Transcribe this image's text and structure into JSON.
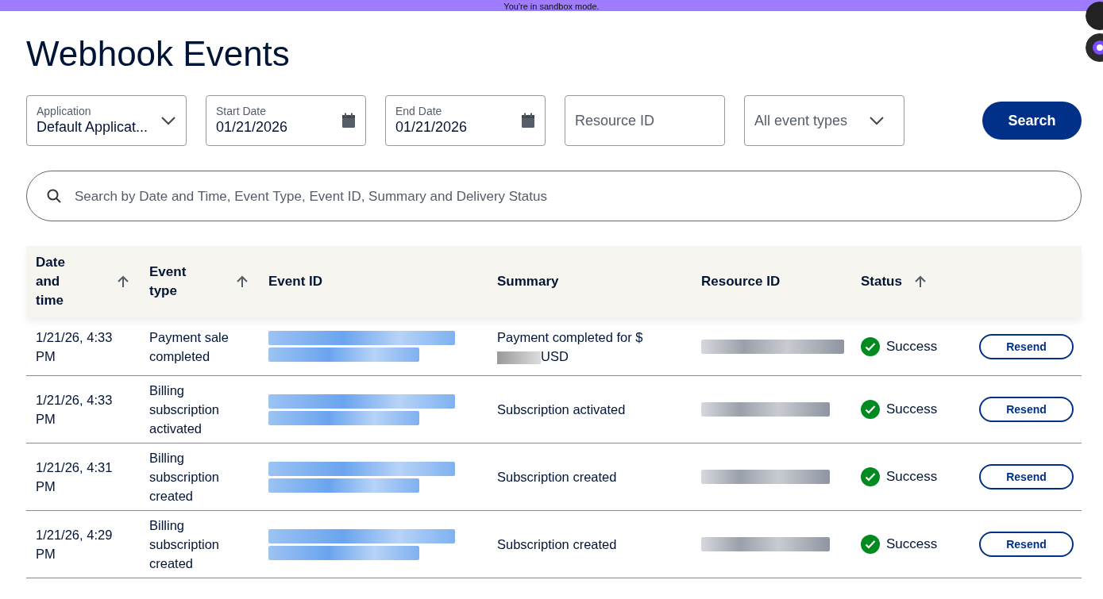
{
  "banner": {
    "text": "You're in sandbox mode."
  },
  "page_title": "Webhook Events",
  "filters": [
    {
      "kind": "select",
      "label": "Application",
      "value": "Default Applicat..."
    },
    {
      "kind": "date",
      "label": "Start Date",
      "value": "01/21/2026"
    },
    {
      "kind": "date",
      "label": "End Date",
      "value": "01/21/2026"
    },
    {
      "kind": "text",
      "placeholder": "Resource ID"
    },
    {
      "kind": "select",
      "value": "All event types"
    }
  ],
  "search_button": "Search",
  "search": {
    "placeholder": "Search by Date and Time, Event Type, Event ID, Summary and Delivery Status"
  },
  "table": {
    "columns": [
      {
        "label": "Date and time",
        "sortable": true
      },
      {
        "label": "Event type",
        "sortable": true
      },
      {
        "label": "Event ID",
        "sortable": false
      },
      {
        "label": "Summary",
        "sortable": false
      },
      {
        "label": "Resource ID",
        "sortable": false
      },
      {
        "label": "Status",
        "sortable": true
      }
    ],
    "rows": [
      {
        "date": "1/21/26, 4:33 PM",
        "event_type": "Payment sale completed",
        "event_id_redacted": true,
        "summary": "Payment completed for $",
        "summary_redacted": true,
        "summary_suffix": "USD",
        "resource_redacted": true,
        "status": {
          "kind": "success",
          "text": "Success"
        },
        "action": "Resend"
      },
      {
        "date": "1/21/26, 4:33 PM",
        "event_type": "Billing subscription activated",
        "event_id_redacted": true,
        "summary": "Subscription activated",
        "resource_redacted": true,
        "status": {
          "kind": "success",
          "text": "Success"
        },
        "action": "Resend"
      },
      {
        "date": "1/21/26, 4:31 PM",
        "event_type": "Billing subscription created",
        "event_id_redacted": true,
        "summary": "Subscription created",
        "resource_redacted": true,
        "status": {
          "kind": "success",
          "text": "Success"
        },
        "action": "Resend"
      },
      {
        "date": "1/21/26, 4:29 PM",
        "event_type": "Billing subscription created",
        "event_id_redacted": true,
        "summary": "Subscription created",
        "resource_redacted": true,
        "status": {
          "kind": "success",
          "text": "Success"
        },
        "action": "Resend"
      }
    ]
  }
}
